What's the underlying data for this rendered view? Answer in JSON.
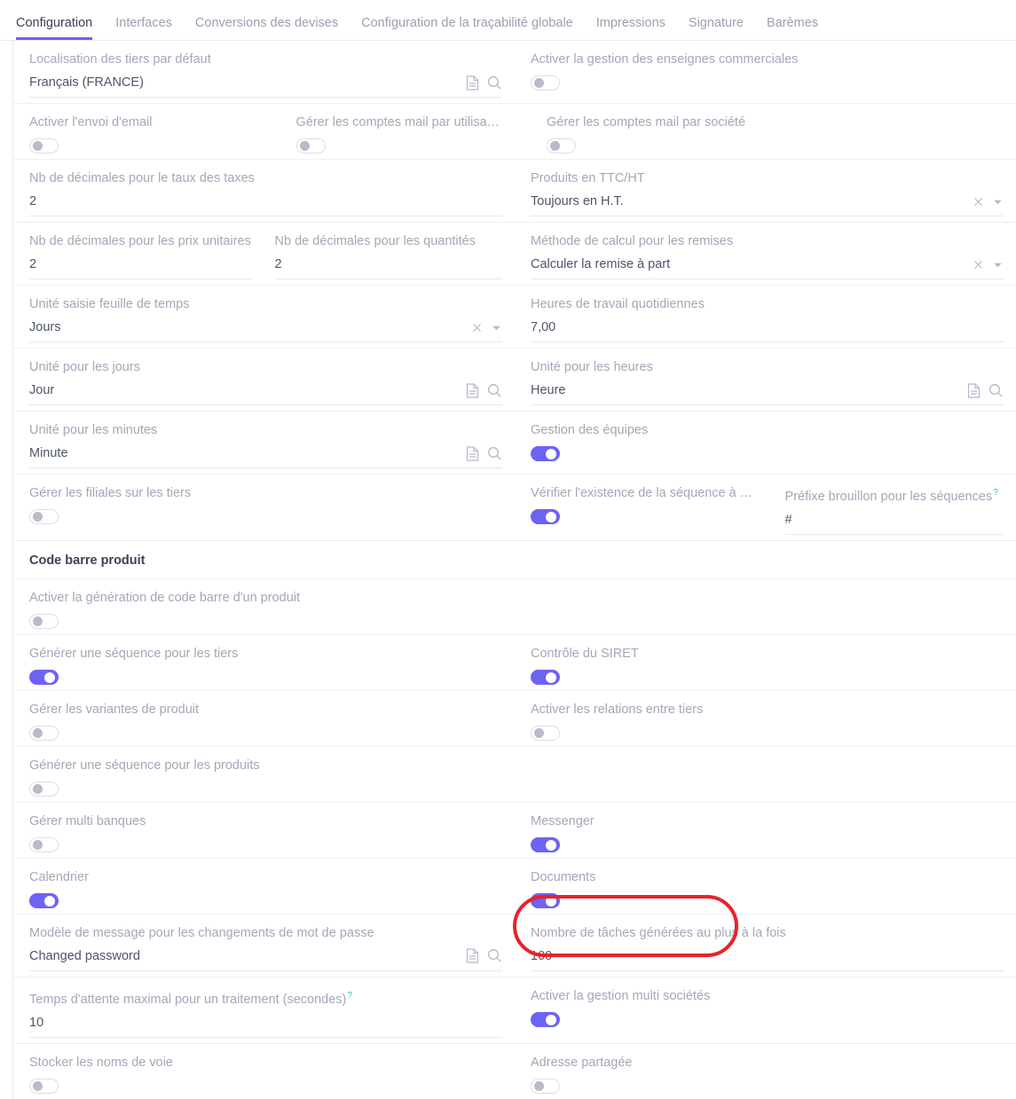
{
  "tabs": [
    {
      "label": "Configuration",
      "active": true
    },
    {
      "label": "Interfaces",
      "active": false
    },
    {
      "label": "Conversions des devises",
      "active": false
    },
    {
      "label": "Configuration de la traçabilité globale",
      "active": false
    },
    {
      "label": "Impressions",
      "active": false
    },
    {
      "label": "Signature",
      "active": false
    },
    {
      "label": "Barèmes",
      "active": false
    }
  ],
  "colors": {
    "accent": "#6c63f5",
    "toggle_on": "#6c63f5",
    "toggle_off_knob": "#b9bcc8",
    "label": "#a2a8b8",
    "value": "#4d5568",
    "help_marker": "#3bbf8f",
    "annotation": "#e8222a",
    "divider": "#eeeff4"
  },
  "fields": {
    "localisation_tiers": {
      "label": "Localisation des tiers par défaut",
      "value": "Français (FRANCE)"
    },
    "enseignes_commerciales": {
      "label": "Activer la gestion des enseignes commerciales",
      "state": "off"
    },
    "envoi_email": {
      "label": "Activer l'envoi d'email",
      "state": "off"
    },
    "comptes_mail_utilisateur": {
      "label": "Gérer les comptes mail par utilisateur",
      "state": "off"
    },
    "comptes_mail_societe": {
      "label": "Gérer les comptes mail par société",
      "state": "off"
    },
    "decimales_taux_taxes": {
      "label": "Nb de décimales pour le taux des taxes",
      "value": "2"
    },
    "produits_ttc_ht": {
      "label": "Produits en TTC/HT",
      "value": "Toujours en H.T."
    },
    "decimales_prix_unitaires": {
      "label": "Nb de décimales pour les prix unitaires",
      "value": "2"
    },
    "decimales_quantites": {
      "label": "Nb de décimales pour les quantités",
      "value": "2"
    },
    "methode_calcul_remises": {
      "label": "Méthode de calcul pour les remises",
      "value": "Calculer la remise à part"
    },
    "unite_feuille_temps": {
      "label": "Unité saisie feuille de temps",
      "value": "Jours"
    },
    "heures_travail": {
      "label": "Heures de travail quotidiennes",
      "value": "7,00"
    },
    "unite_jours": {
      "label": "Unité pour les jours",
      "value": "Jour"
    },
    "unite_heures": {
      "label": "Unité pour les heures",
      "value": "Heure"
    },
    "unite_minutes": {
      "label": "Unité pour les minutes",
      "value": "Minute"
    },
    "gestion_equipes": {
      "label": "Gestion des équipes",
      "state": "on"
    },
    "filiales_tiers": {
      "label": "Gérer les filiales sur les tiers",
      "state": "off"
    },
    "verifier_sequence": {
      "label": "Vérifier l'existence de la séquence à la ...",
      "state": "on"
    },
    "prefixe_brouillon": {
      "label": "Préfixe brouillon pour les séquences",
      "help": "?",
      "value": "#"
    },
    "section_code_barre": {
      "title": "Code barre produit"
    },
    "generation_code_barre": {
      "label": "Activer la génération de code barre d'un produit",
      "state": "off"
    },
    "sequence_tiers": {
      "label": "Générer une séquence pour les tiers",
      "state": "on"
    },
    "controle_siret": {
      "label": "Contrôle du SIRET",
      "state": "on"
    },
    "variantes_produit": {
      "label": "Gérer les variantes de produit",
      "state": "off"
    },
    "relations_tiers": {
      "label": "Activer les relations entre tiers",
      "state": "off"
    },
    "sequence_produits": {
      "label": "Générer une séquence pour les produits",
      "state": "off"
    },
    "multi_banques": {
      "label": "Gérer multi banques",
      "state": "off"
    },
    "messenger": {
      "label": "Messenger",
      "state": "on"
    },
    "calendrier": {
      "label": "Calendrier",
      "state": "on"
    },
    "documents": {
      "label": "Documents",
      "state": "on"
    },
    "modele_message_mdp": {
      "label": "Modèle de message pour les changements de mot de passe",
      "value": "Changed password"
    },
    "nombre_taches": {
      "label": "Nombre de tâches générées au plus à la fois",
      "value": "100"
    },
    "temps_attente": {
      "label": "Temps d'attente maximal pour un traitement (secondes)",
      "help": "?",
      "value": "10"
    },
    "multi_societes": {
      "label": "Activer la gestion multi sociétés",
      "state": "on"
    },
    "noms_de_voie": {
      "label": "Stocker les noms de voie",
      "state": "off"
    },
    "adresse_partagee": {
      "label": "Adresse partagée",
      "state": "off"
    }
  },
  "icons": {
    "document": "document-icon",
    "search": "search-icon",
    "clear": "clear-icon",
    "dropdown": "chevron-down-icon"
  },
  "annotation": {
    "shape": "rounded-rectangle",
    "target": "multi_societes",
    "color": "#e8222a"
  }
}
